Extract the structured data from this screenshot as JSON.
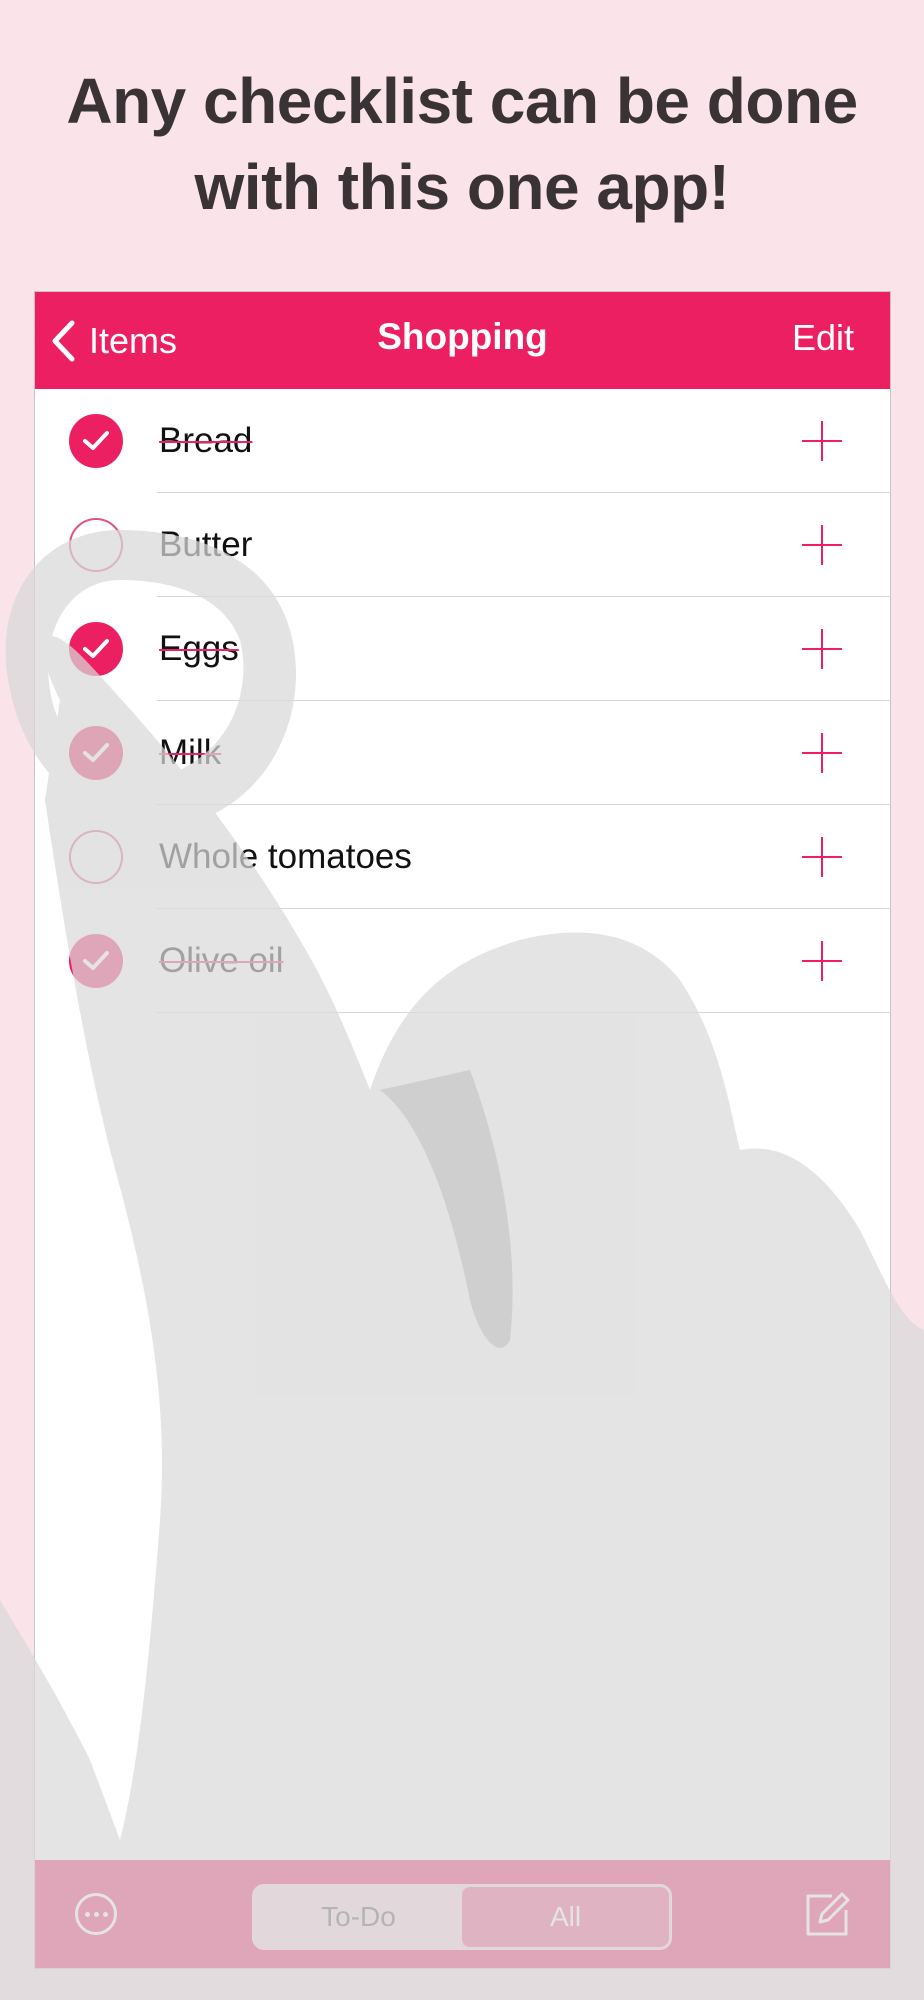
{
  "headline": {
    "line1": "Any checklist can be done",
    "line2": "with this one app!"
  },
  "navbar": {
    "back_label": "Items",
    "title": "Shopping",
    "edit_label": "Edit",
    "color": "#ec1f62"
  },
  "items": [
    {
      "label": "Bread",
      "checked": true
    },
    {
      "label": "Butter",
      "checked": false
    },
    {
      "label": "Eggs",
      "checked": true
    },
    {
      "label": "Milk",
      "checked": true
    },
    {
      "label": "Whole tomatoes",
      "checked": false
    },
    {
      "label": "Olive oil",
      "checked": true
    }
  ],
  "toolbar": {
    "segments": [
      "To-Do",
      "All"
    ],
    "selected_segment": "All",
    "more_icon": "ellipsis-circle-icon",
    "compose_icon": "compose-icon"
  },
  "colors": {
    "background": "#fbe3ea",
    "accent": "#ec1f62",
    "hand_overlay": "#d9d9d9"
  }
}
